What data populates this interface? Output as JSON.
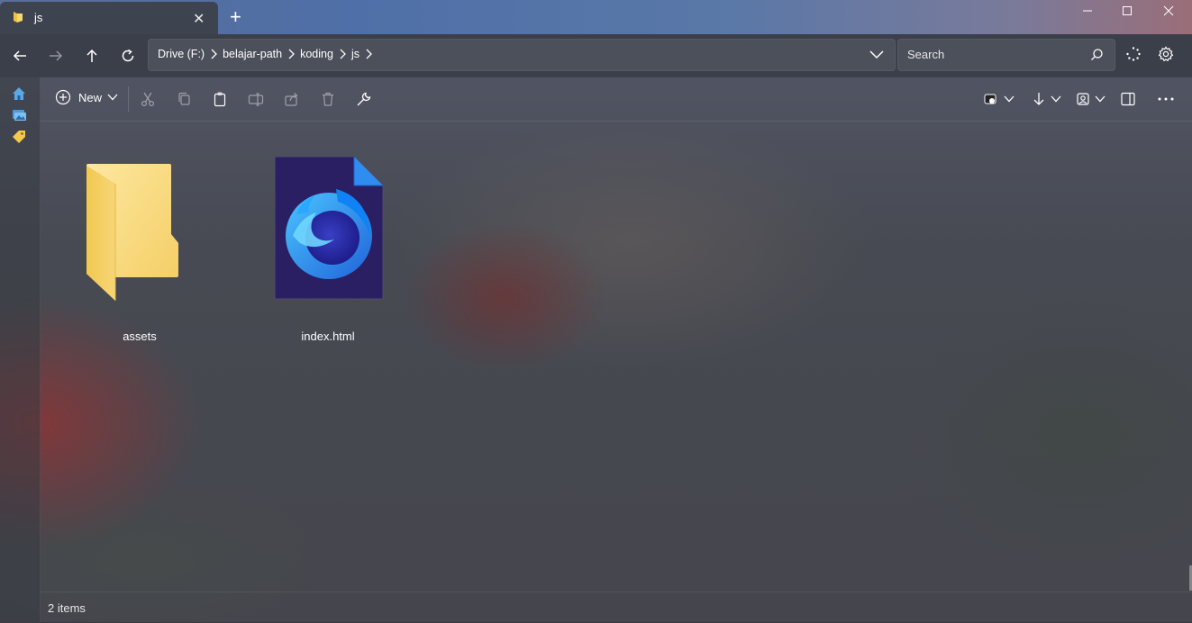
{
  "window": {
    "tab_title": "js",
    "tab_icon": "folder-icon",
    "minimize_label": "—",
    "maximize_label": "□",
    "close_label": "✕"
  },
  "nav": {
    "breadcrumbs": [
      "Drive (F:)",
      "belajar-path",
      "koding",
      "js"
    ],
    "search_placeholder": "Search"
  },
  "toolbar": {
    "new_label": "New"
  },
  "files": [
    {
      "name": "assets",
      "type": "folder"
    },
    {
      "name": "index.html",
      "type": "html-file"
    }
  ],
  "status": {
    "item_count": "2 items"
  },
  "colors": {
    "folder_yellow": "#f5d36e",
    "html_icon_bg": "#2b1f63",
    "html_icon_blue": "#2f8df0",
    "accent_tab": "#3e4350"
  }
}
